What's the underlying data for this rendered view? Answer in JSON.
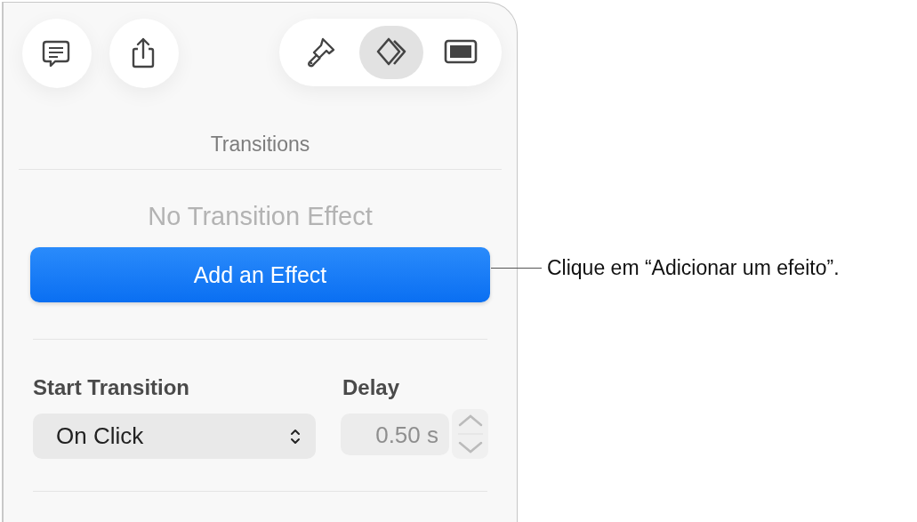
{
  "toolbar": {
    "left_buttons": [
      {
        "kind": "comment"
      },
      {
        "kind": "share"
      }
    ],
    "tabs": [
      {
        "kind": "format",
        "selected": false
      },
      {
        "kind": "animate",
        "selected": true
      },
      {
        "kind": "document",
        "selected": false
      }
    ]
  },
  "panel": {
    "title": "Transitions",
    "effect_name": "No Transition Effect",
    "add_button": "Add an Effect",
    "start_label": "Start Transition",
    "start_value": "On Click",
    "delay_label": "Delay",
    "delay_value": "0.50 s",
    "delay_disabled": true
  },
  "callout": {
    "text": "Clique em “Adicionar um efeito”."
  }
}
